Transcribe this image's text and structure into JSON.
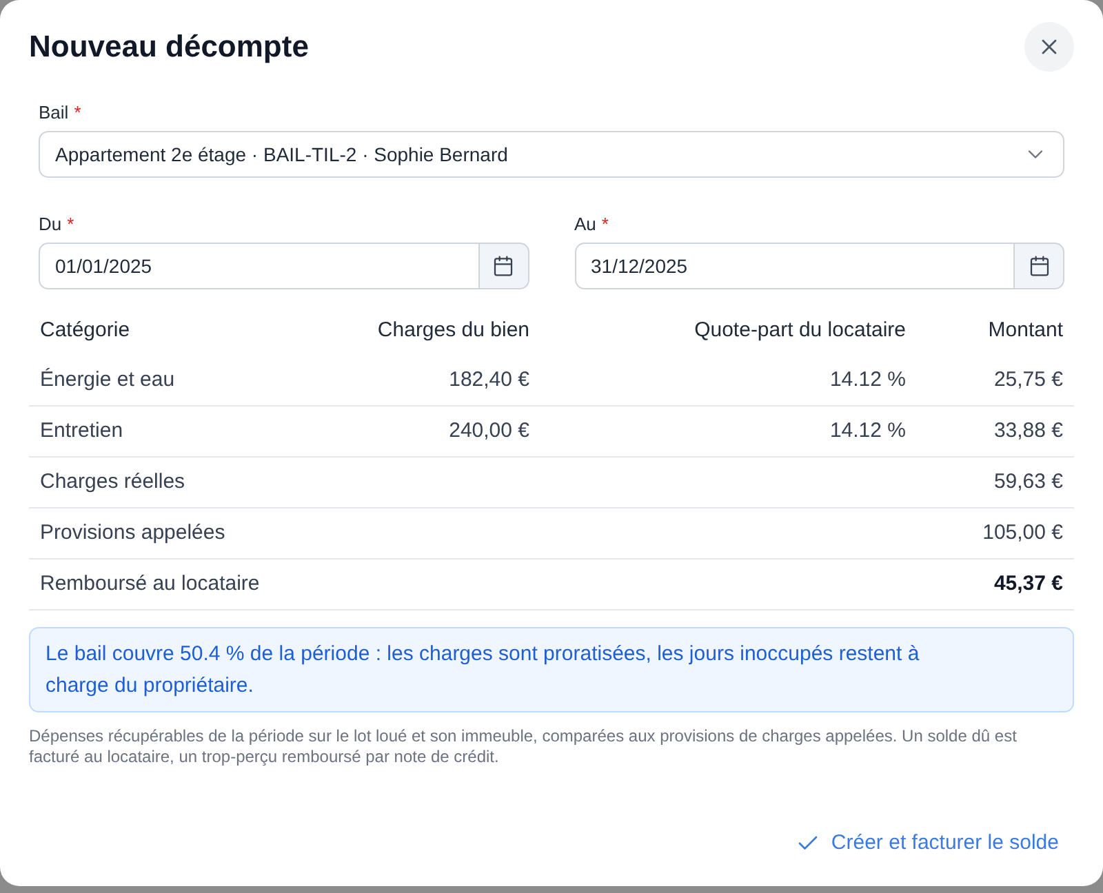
{
  "dialog": {
    "title": "Nouveau décompte"
  },
  "lease_field": {
    "label": "Bail",
    "required_mark": "*",
    "value": "Appartement 2e étage · BAIL-TIL-2 · Sophie Bernard"
  },
  "date_fields": [
    {
      "label": "Du",
      "required_mark": "*",
      "value": "01/01/2025"
    },
    {
      "label": "Au",
      "required_mark": "*",
      "value": "31/12/2025"
    }
  ],
  "table": {
    "columns": [
      "Catégorie",
      "Charges du bien",
      "Quote-part du locataire",
      "Montant"
    ],
    "rows": [
      {
        "category": "Énergie et eau",
        "charges": "182,40 €",
        "share": "14.12 %",
        "amount": "25,75 €",
        "strong": false
      },
      {
        "category": "Entretien",
        "charges": "240,00 €",
        "share": "14.12 %",
        "amount": "33,88 €",
        "strong": false
      },
      {
        "category": "Charges réelles",
        "amount": "59,63 €",
        "strong": false
      },
      {
        "category": "Provisions appelées",
        "amount": "105,00 €",
        "strong": false
      },
      {
        "category": "Remboursé au locataire",
        "amount": "45,37 €",
        "strong": true
      }
    ]
  },
  "notice": {
    "text": "Le bail couvre 50.4 % de la période : les charges sont proratisées, les jours inoccupés restent à charge du propriétaire."
  },
  "footnote": {
    "text": "Dépenses récupérables de la période sur le lot loué et son immeuble, comparées aux provisions de charges appelées. Un solde dû est facturé au locataire, un trop-perçu remboursé par note de crédit."
  },
  "footer": {
    "primary_action": "Créer et facturer le solde"
  }
}
